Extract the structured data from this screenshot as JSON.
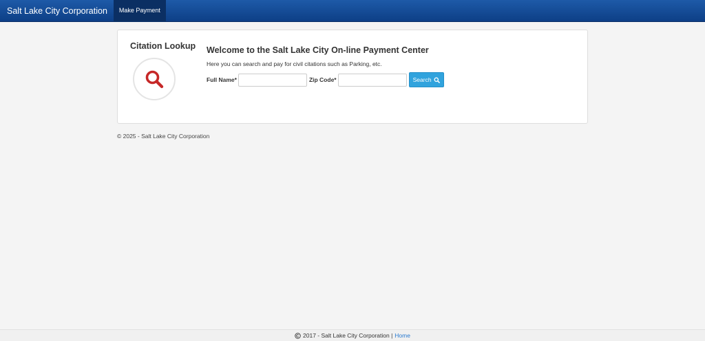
{
  "navbar": {
    "brand": "Salt Lake City Corporation",
    "items": [
      {
        "label": "Make Payment"
      }
    ]
  },
  "lookup": {
    "title": "Citation Lookup",
    "icon": "search-icon",
    "icon_color": "#c62828"
  },
  "welcome": {
    "title": "Welcome to the Salt Lake City On-line Payment Center",
    "subtitle": "Here you can search and pay for civil citations such as Parking, etc."
  },
  "form": {
    "full_name_label": "Full Name*",
    "full_name_value": "",
    "zip_label": "Zip Code*",
    "zip_value": "",
    "search_label": "Search"
  },
  "copyright": "© 2025 - Salt Lake City Corporation",
  "footer": {
    "text": "2017 - Salt Lake City Corporation |",
    "link_label": "Home"
  },
  "colors": {
    "navbar": "#0d3f86",
    "accent": "#31a3dd",
    "link": "#2a7bd0"
  }
}
